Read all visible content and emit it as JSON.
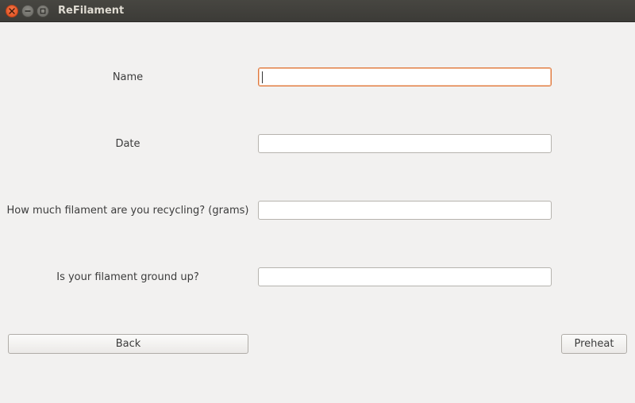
{
  "window": {
    "title": "ReFilament",
    "controls": [
      "close-icon",
      "minimize-icon",
      "maximize-icon"
    ]
  },
  "form": {
    "fields": [
      {
        "label": "Name",
        "value": "",
        "focused": true
      },
      {
        "label": "Date",
        "value": ""
      },
      {
        "label": "How much filament are you recycling? (grams)",
        "value": ""
      },
      {
        "label": "Is your filament ground up?",
        "value": ""
      }
    ]
  },
  "buttons": {
    "back_label": "Back",
    "preheat_label": "Preheat"
  },
  "colors": {
    "focus_border": "#e0793e",
    "titlebar": "#3c3b37",
    "close_button": "#de4b1b"
  }
}
